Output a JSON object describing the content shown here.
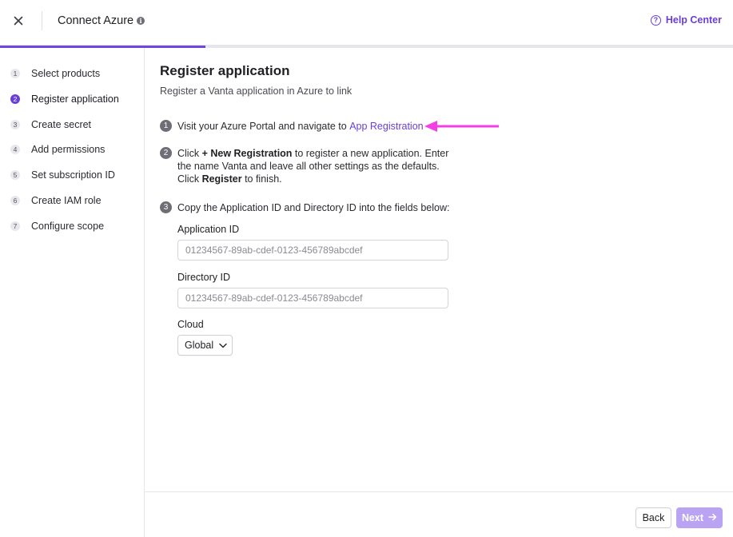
{
  "header": {
    "title": "Connect Azure",
    "help_label": "Help Center",
    "close_icon": "close-icon",
    "info_icon": "info-icon"
  },
  "progress": {
    "fraction": 0.28,
    "color": "#7045e0"
  },
  "sidebar": {
    "steps": [
      {
        "num": "1",
        "label": "Select products"
      },
      {
        "num": "2",
        "label": "Register application",
        "active": true
      },
      {
        "num": "3",
        "label": "Create secret"
      },
      {
        "num": "4",
        "label": "Add permissions"
      },
      {
        "num": "5",
        "label": "Set subscription ID"
      },
      {
        "num": "6",
        "label": "Create IAM role"
      },
      {
        "num": "7",
        "label": "Configure scope"
      }
    ]
  },
  "main": {
    "title": "Register application",
    "subtitle": "Register a Vanta application in Azure to link",
    "step1": {
      "num": "1",
      "text": "Visit your Azure Portal and navigate to",
      "link": "App Registration"
    },
    "step2": {
      "num": "2",
      "p1": "Click ",
      "b1": "+ New Registration",
      "p2": " to register a new application. Enter the name Vanta and leave all other settings as the defaults. Click ",
      "b2": "Register",
      "p3": " to finish."
    },
    "step3": {
      "num": "3",
      "text": "Copy the Application ID and Directory ID into the fields below:"
    },
    "application_id": {
      "label": "Application ID",
      "value": "",
      "placeholder": "01234567-89ab-cdef-0123-456789abcdef"
    },
    "directory_id": {
      "label": "Directory ID",
      "value": "",
      "placeholder": "01234567-89ab-cdef-0123-456789abcdef"
    },
    "cloud": {
      "label": "Cloud",
      "selected": "Global"
    }
  },
  "footer": {
    "back_label": "Back",
    "next_label": "Next"
  },
  "colors": {
    "accent": "#6a3fd7",
    "annotation_arrow": "#f33fe3",
    "next_disabled": "#b9a3f2"
  }
}
